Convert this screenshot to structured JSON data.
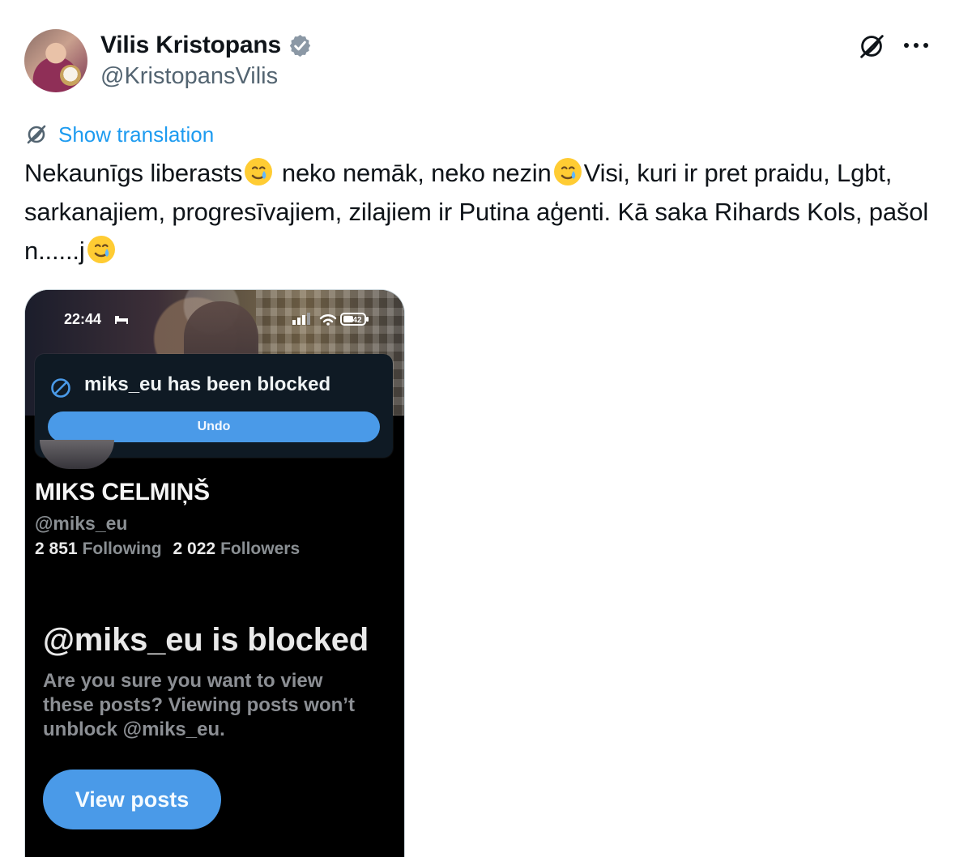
{
  "post": {
    "author": {
      "name": "Vilis Kristopans",
      "handle": "@KristopansVilis"
    },
    "translation_link": "Show translation",
    "text_parts": [
      "Nekaunīgs liberasts",
      " neko nemāk, neko nezin",
      "Visi, kuri ir pret praidu, Lgbt, sarkanajiem, progresīvajiem, zilajiem ir Putina aģenti. Kā saka Rihards Kols, pašol n......j"
    ]
  },
  "screenshot": {
    "status": {
      "time": "22:44",
      "battery": "42"
    },
    "toast": {
      "message": "miks_eu has been blocked",
      "undo_label": "Undo"
    },
    "profile": {
      "name": "MIKS CELMIŅŠ",
      "handle": "@miks_eu",
      "following_count": "2 851",
      "following_label": "Following",
      "followers_count": "2 022",
      "followers_label": "Followers"
    },
    "blocked": {
      "title": "@miks_eu is blocked",
      "description": "Are you sure you want to view these posts? Viewing posts won’t unblock @miks_eu.",
      "button_label": "View posts"
    }
  },
  "icons": {
    "verified": "verified-badge-icon",
    "grok": "grok-icon",
    "more": "more-icon",
    "translation": "translation-icon",
    "emoji": "smiling-face-with-tear-icon",
    "block": "block-icon"
  },
  "colors": {
    "link": "#1d9bf0",
    "secondary_text": "#536471",
    "button_blue": "#4a9ae8"
  }
}
